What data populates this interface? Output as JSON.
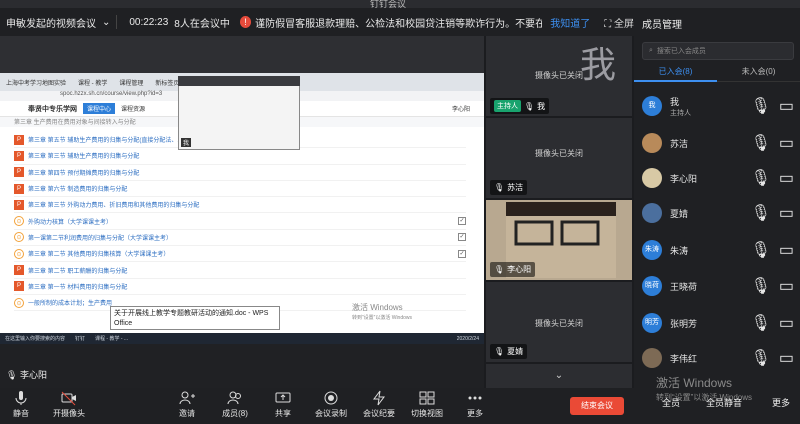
{
  "window": {
    "title": "钉钉会议"
  },
  "topbar": {
    "meeting_name": "申敏发起的视频会议",
    "timer": "00:22:23",
    "participants": "8人在会议中",
    "notice": "谨防假冒客服退款理赔、公检法和校园贷注销等欺诈行为。不要在“共享屏幕”",
    "know": "我知道了",
    "fullscreen": "全屏"
  },
  "shared_screen": {
    "tabs": [
      "上海中考学习地图实验",
      "课程 - 教学",
      "课程管理",
      "新标签页"
    ],
    "url": "spoc.hzzx.sh.cn/course/view.php?id=3",
    "site_name": "奉贤中专乐学网",
    "site_button": "课程中心",
    "site_menu": "课程资源",
    "user": "李心阳",
    "crumb": "第三章 生产费用在费用对象与间接转入与分配",
    "chapters": [
      {
        "icon": "ppt",
        "text": "第三章 第五节 辅助生产费用的归集与分配(直接分配法、...",
        "check": false
      },
      {
        "icon": "ppt",
        "text": "第三章 第三节 辅助生产费用的归集与分配",
        "check": false
      },
      {
        "icon": "ppt",
        "text": "第三章 第四节 预付期摊费用的归集与分配",
        "check": false
      },
      {
        "icon": "ppt",
        "text": "第三章 第六节 制造费用的归集与分配",
        "check": false
      },
      {
        "icon": "ppt",
        "text": "第三章 第三节 外购动力费用、折旧费用和其他费用的归集与分配",
        "check": false
      },
      {
        "icon": "circle",
        "text": "外购动力核算（大学课课主考）",
        "check": true
      },
      {
        "icon": "circle",
        "text": "第一课第二节利润费用的归集与分配（大学课课主考）",
        "check": true
      },
      {
        "icon": "circle",
        "text": "第三章 第二节 其他费用的归集核算（大学课课主考）",
        "check": true
      },
      {
        "icon": "ppt",
        "text": "第三章 第二节 职工薪酬的归集与分配",
        "check": false
      },
      {
        "icon": "ppt",
        "text": "第三章 第一节 材料费用的归集与分配",
        "check": false
      },
      {
        "icon": "circle",
        "text": "一般所制的成本计划；生产费用",
        "check": false
      }
    ],
    "tooltip": "关于开展线上教学专题教研活动的通知.doc - WPS Office",
    "activate": "激活 Windows",
    "activate_sub": "转到“设置”以激活 Windows",
    "taskbar": [
      "在这里输入你要搜索的内容",
      "钉钉",
      "课程 - 教学 - ...",
      "2020/2/24"
    ],
    "mini_window_mic": "我",
    "sharer": "李心阳"
  },
  "tiles": [
    {
      "status": "摄像头已关闭",
      "name": "我",
      "host": "主持人",
      "avatar_text": "我"
    },
    {
      "status": "摄像头已关闭",
      "name": "苏洁"
    },
    {
      "status": "",
      "name": "李心阳"
    },
    {
      "status": "摄像头已关闭",
      "name": "夏婧"
    },
    {
      "status": "",
      "name": ""
    }
  ],
  "sidebar": {
    "title": "成员管理",
    "search_placeholder": "搜索已入会成员",
    "tab_in": "已入会(8)",
    "tab_out": "未入会(0)",
    "members": [
      {
        "name": "我",
        "role": "主持人",
        "avatar": "我",
        "color": "#2d7ed8"
      },
      {
        "name": "苏洁",
        "role": "",
        "avatar": "",
        "color": "#b88a5a"
      },
      {
        "name": "李心阳",
        "role": "",
        "avatar": "",
        "color": "#d8c9a5"
      },
      {
        "name": "夏婧",
        "role": "",
        "avatar": "",
        "color": "#4b6f9e"
      },
      {
        "name": "朱涛",
        "role": "",
        "avatar": "朱涛",
        "color": "#2d7ed8"
      },
      {
        "name": "王晓荷",
        "role": "",
        "avatar": "晓荷",
        "color": "#2d7ed8"
      },
      {
        "name": "张明芳",
        "role": "",
        "avatar": "明芳",
        "color": "#2d7ed8"
      },
      {
        "name": "李伟红",
        "role": "",
        "avatar": "",
        "color": "#7d6a55"
      }
    ],
    "watermark": "激活 Windows",
    "watermark_sub": "转到“设置”以激活 Windows",
    "invite_all": "全员",
    "mute_all": "全员静音",
    "more": "更多"
  },
  "toolbar": {
    "mute": "静音",
    "camera": "开摄像头",
    "invite": "邀请",
    "members": "成员(8)",
    "share": "共享",
    "record": "会议录制",
    "minutes": "会议纪要",
    "switch_view": "切换视图",
    "more": "更多",
    "end": "结束会议"
  }
}
